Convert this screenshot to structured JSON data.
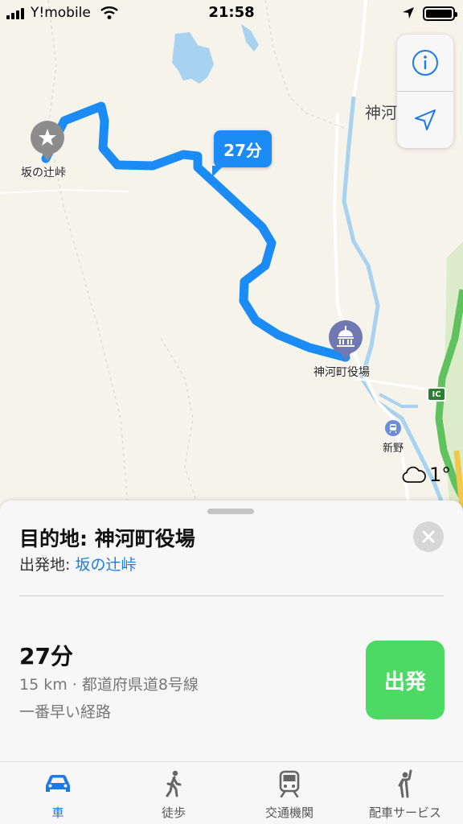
{
  "status_bar": {
    "carrier": "Y!mobile",
    "time": "21:58"
  },
  "map": {
    "labels": {
      "start": "坂の辻峠",
      "destination": "神河町役場",
      "town": "神河",
      "station": "新野",
      "interchange": "IC"
    },
    "eta_bubble": "27分",
    "weather": {
      "temperature": "1°",
      "icon": "cloud-icon"
    },
    "controls": {
      "info_icon": "info-icon",
      "locate_icon": "location-arrow-icon"
    },
    "colors": {
      "route": "#1b8cf5",
      "pin_gray": "#8c8c8c",
      "pin_purple": "#6f78b0",
      "water": "#a7d3f0"
    }
  },
  "sheet": {
    "destination": "目的地: 神河町役場",
    "origin_label": "出発地: ",
    "origin_link": "坂の辻峠",
    "route": {
      "time": "27分",
      "meta": "15 km · 都道府県道8号線",
      "note": "一番早い経路"
    },
    "go_button": "出発",
    "colors": {
      "go": "#4cd964",
      "link": "#1a7ae8"
    }
  },
  "tab_bar": {
    "active_tab": "車",
    "tabs": [
      {
        "label": "車",
        "icon": "car-icon"
      },
      {
        "label": "徒歩",
        "icon": "walking-icon"
      },
      {
        "label": "交通機関",
        "icon": "train-icon"
      },
      {
        "label": "配車サービス",
        "icon": "ride-hailing-icon"
      }
    ]
  }
}
